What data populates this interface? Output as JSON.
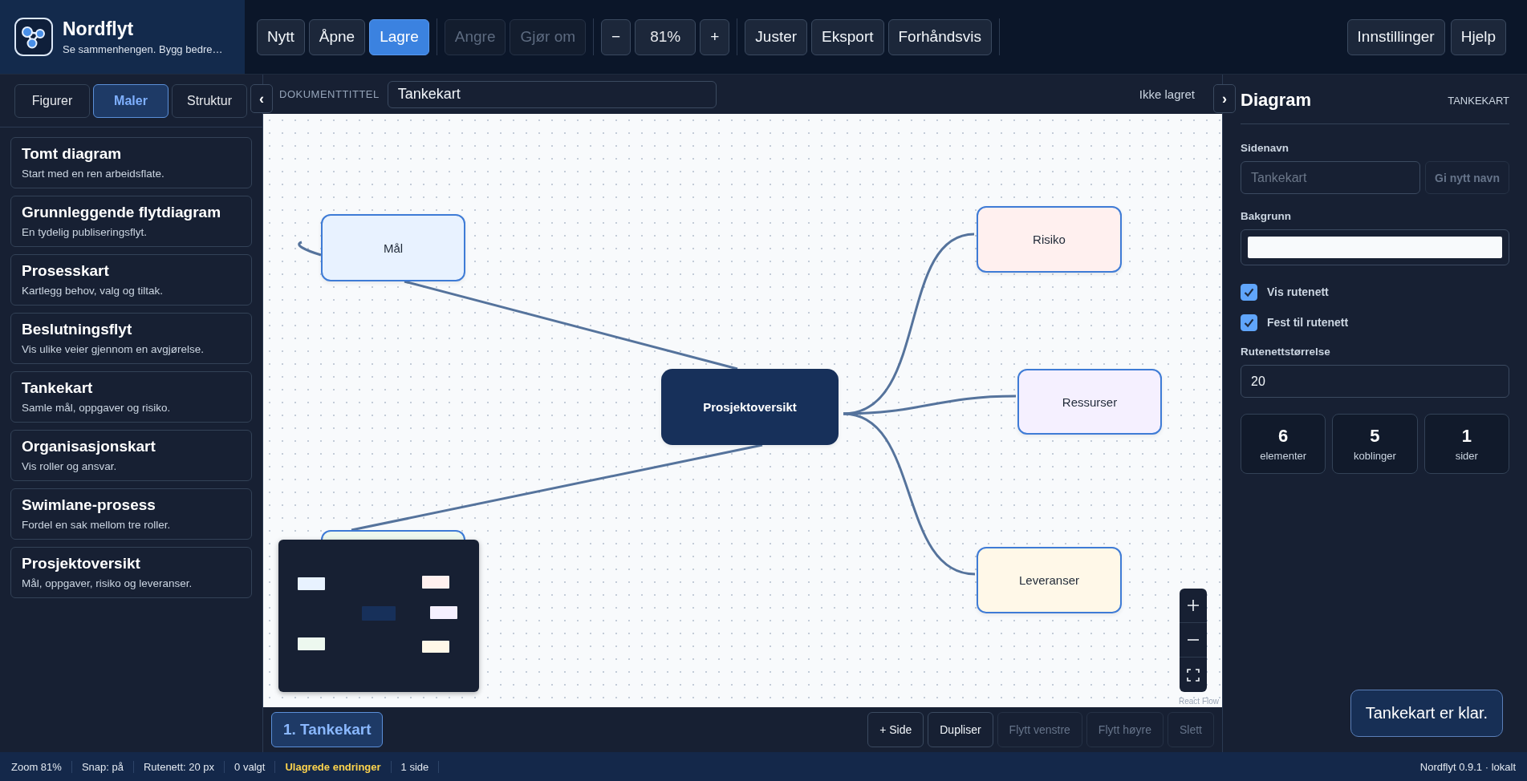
{
  "app": {
    "name": "Nordflyt",
    "tagline": "Se sammenhengen. Bygg bedre…"
  },
  "toolbar": {
    "groups": [
      {
        "items": [
          {
            "kind": "button",
            "label": "Nytt",
            "primary": false,
            "disabled": false
          },
          {
            "kind": "button",
            "label": "Åpne",
            "primary": false,
            "disabled": false
          },
          {
            "kind": "button",
            "label": "Lagre",
            "primary": true,
            "disabled": false
          }
        ]
      },
      {
        "items": [
          {
            "kind": "button",
            "label": "Angre",
            "primary": false,
            "disabled": true
          },
          {
            "kind": "button",
            "label": "Gjør om",
            "primary": false,
            "disabled": true
          }
        ]
      },
      {
        "items": [
          {
            "kind": "button",
            "label": "−",
            "primary": false,
            "disabled": false
          },
          {
            "kind": "readout",
            "label": "81%"
          },
          {
            "kind": "button",
            "label": "+",
            "primary": false,
            "disabled": false
          }
        ]
      },
      {
        "items": [
          {
            "kind": "button",
            "label": "Juster",
            "primary": false,
            "disabled": false
          },
          {
            "kind": "button",
            "label": "Eksport",
            "primary": false,
            "disabled": false
          },
          {
            "kind": "button",
            "label": "Forhåndsvis",
            "primary": false,
            "disabled": false
          }
        ]
      }
    ],
    "right": [
      {
        "label": "Innstillinger"
      },
      {
        "label": "Hjelp"
      }
    ]
  },
  "sidebar": {
    "tabs": [
      {
        "label": "Figurer",
        "selected": false
      },
      {
        "label": "Maler",
        "selected": true
      },
      {
        "label": "Struktur",
        "selected": false
      }
    ],
    "templates": [
      {
        "title": "Tomt diagram",
        "description": "Start med en ren arbeidsflate."
      },
      {
        "title": "Grunnleggende flytdiagram",
        "description": "En tydelig publiseringsflyt."
      },
      {
        "title": "Prosesskart",
        "description": "Kartlegg behov, valg og tiltak."
      },
      {
        "title": "Beslutningsflyt",
        "description": "Vis ulike veier gjennom en avgjørelse."
      },
      {
        "title": "Tankekart",
        "description": "Samle mål, oppgaver og risiko."
      },
      {
        "title": "Organisasjonskart",
        "description": "Vis roller og ansvar."
      },
      {
        "title": "Swimlane-prosess",
        "description": "Fordel en sak mellom tre roller."
      },
      {
        "title": "Prosjektoversikt",
        "description": "Mål, oppgaver, risiko og leveranser."
      }
    ]
  },
  "toggles": {
    "left": "‹",
    "right": "›"
  },
  "document": {
    "label": "DOKUMENTTITTEL",
    "title": "Tankekart",
    "save_state": "Ikke lagret"
  },
  "canvas": {
    "nodes": [
      {
        "kind": "topic",
        "label": "Mål",
        "color": "#e8f2ff"
      },
      {
        "kind": "topic",
        "label": "Risiko",
        "color": "#fff0ef"
      },
      {
        "kind": "root",
        "label": "Prosjektoversikt",
        "color": "#17305a"
      },
      {
        "kind": "topic",
        "label": "Ressurser",
        "color": "#f5f0ff"
      },
      {
        "kind": "topic",
        "color": "#edf8ef"
      },
      {
        "kind": "topic",
        "label": "Leveranser",
        "color": "#fff8e8"
      }
    ],
    "attribution": "React Flow"
  },
  "pages": {
    "tabs": [
      {
        "label": "1. Tankekart",
        "selected": true
      }
    ],
    "actions": [
      {
        "label": "+ Side",
        "disabled": false
      },
      {
        "label": "Dupliser",
        "disabled": false
      },
      {
        "label": "Flytt venstre",
        "disabled": true
      },
      {
        "label": "Flytt høyre",
        "disabled": true
      },
      {
        "label": "Slett",
        "disabled": true
      }
    ]
  },
  "panel": {
    "title": "Diagram",
    "subtitle": "TANKEKART",
    "page_name": {
      "label": "Sidenavn",
      "placeholder": "Tankekart",
      "button": {
        "label": "Gi nytt navn",
        "disabled": true
      }
    },
    "background": {
      "label": "Bakgrunn",
      "color": "#f8fafc"
    },
    "options": [
      {
        "label": "Vis rutenett",
        "checked": true
      },
      {
        "label": "Fest til rutenett",
        "checked": true
      }
    ],
    "grid_size": {
      "label": "Rutenettstørrelse",
      "value": "20"
    },
    "stats": [
      {
        "value": "6",
        "label": "elementer"
      },
      {
        "value": "5",
        "label": "koblinger"
      },
      {
        "value": "1",
        "label": "sider"
      }
    ]
  },
  "toast": "Tankekart er klar.",
  "status_bar": {
    "items": [
      {
        "kind": "plain",
        "text": "Zoom 81%"
      },
      {
        "kind": "plain",
        "text": "Snap: på"
      },
      {
        "kind": "plain",
        "text": "Rutenett: 20 px"
      },
      {
        "kind": "plain",
        "text": "0 valgt"
      },
      {
        "kind": "warning",
        "text": "Ulagrede endringer"
      },
      {
        "kind": "plain",
        "text": "1 side"
      }
    ],
    "version": "Nordflyt 0.9.1 · lokalt"
  }
}
